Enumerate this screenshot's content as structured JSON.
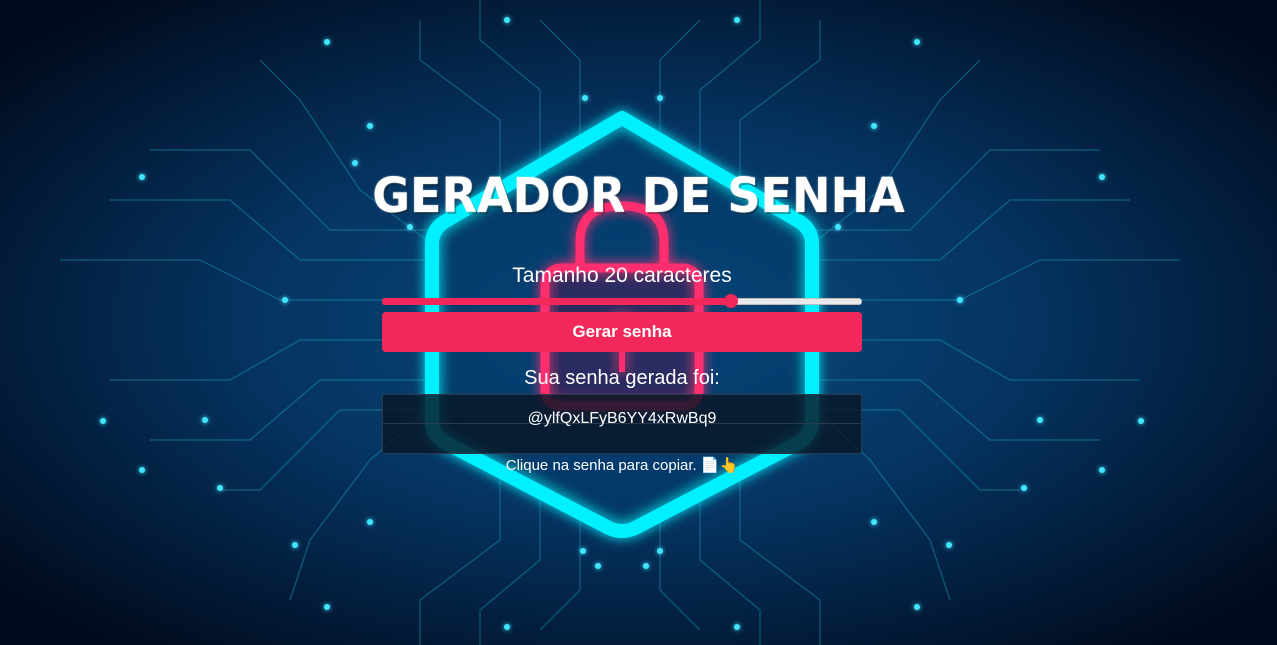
{
  "title": "GERADOR DE SENHA",
  "length": {
    "label": "Tamanho 20 caracteres",
    "value": 20,
    "min": 1,
    "max": 27
  },
  "generate_button": "Gerar senha",
  "result_label": "Sua senha gerada foi:",
  "password": "@ylfQxLFyB6YY4xRwBq9",
  "copy_hint": "Clique na senha para copiar. 📄👆",
  "colors": {
    "accent": "#f4275a",
    "neon_cyan": "#00f0ff",
    "neon_pink": "#ff2d6e",
    "background": "#021028"
  },
  "icons": {
    "background": "neon-padlock-circuit",
    "hint": "document-and-pointing-hand"
  }
}
